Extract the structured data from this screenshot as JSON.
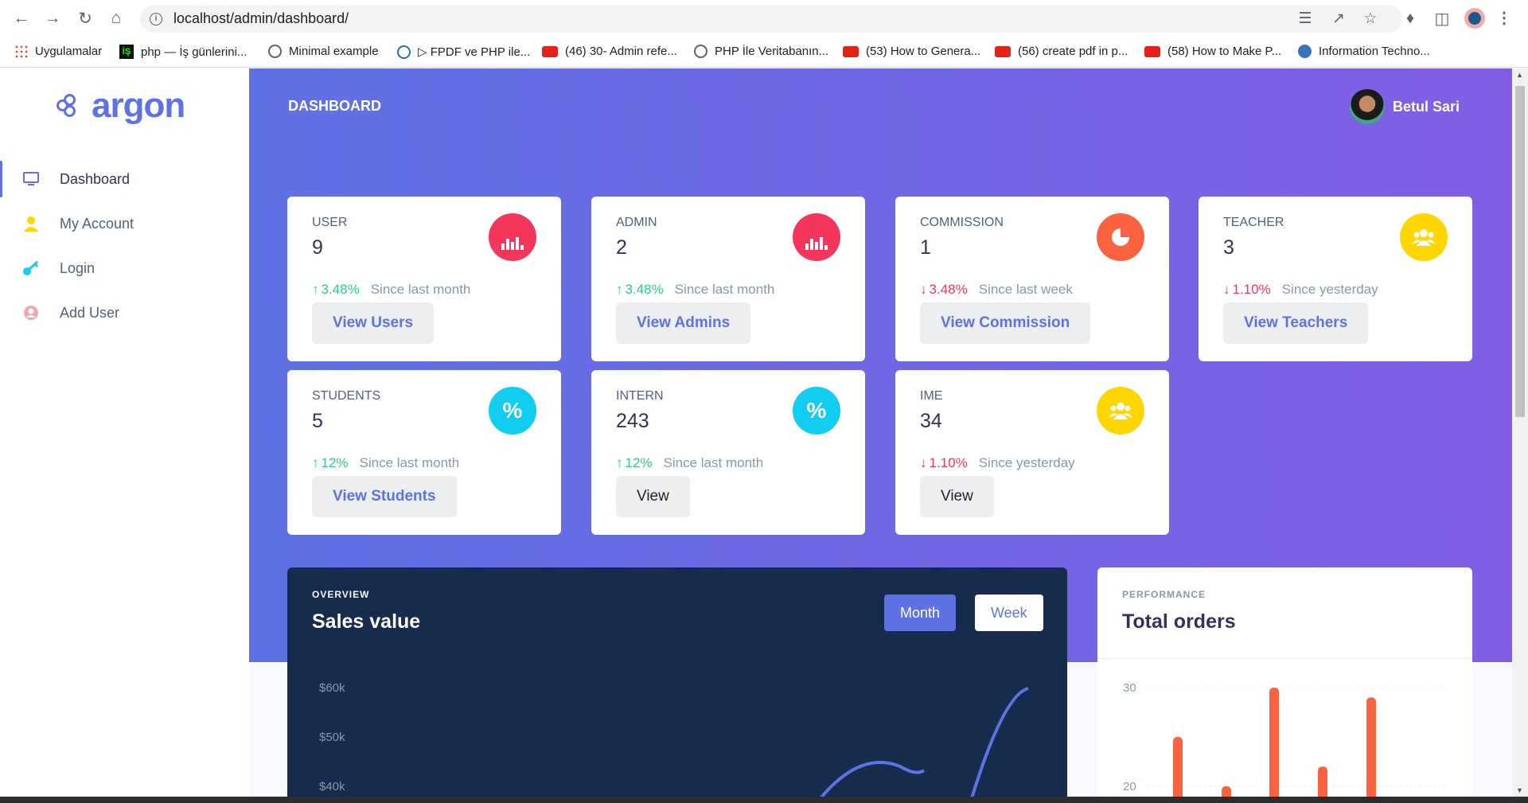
{
  "browser": {
    "url": "localhost/admin/dashboard/",
    "bookmarks": [
      {
        "label": "Uygulamalar",
        "icon": "apps-grid-icon"
      },
      {
        "label": "php — İş günlerini...",
        "icon": "php-favicon-icon"
      },
      {
        "label": "Minimal example",
        "icon": "globe-icon"
      },
      {
        "label": "▷ FPDF ve PHP ile...",
        "icon": "wordpress-icon"
      },
      {
        "label": "(46) 30- Admin refe...",
        "icon": "youtube-icon"
      },
      {
        "label": "PHP İle Veritabanın...",
        "icon": "globe-icon"
      },
      {
        "label": "(53) How to Genera...",
        "icon": "youtube-icon"
      },
      {
        "label": "(56) create pdf in p...",
        "icon": "youtube-icon"
      },
      {
        "label": "(58) How to Make P...",
        "icon": "youtube-icon"
      },
      {
        "label": "Information Techno...",
        "icon": "ge-icon"
      }
    ],
    "more_bookmarks": "»"
  },
  "sidebar": {
    "brand": "argon",
    "items": [
      {
        "label": "Dashboard",
        "icon": "monitor-icon",
        "color": "#5e72e4"
      },
      {
        "label": "My Account",
        "icon": "user-icon",
        "color": "#ffd600"
      },
      {
        "label": "Login",
        "icon": "key-icon",
        "color": "#11cdef"
      },
      {
        "label": "Add User",
        "icon": "user-circle-icon",
        "color": "#f3a4b5"
      }
    ]
  },
  "header": {
    "title": "DASHBOARD",
    "user_name": "Betul Sari"
  },
  "cards": [
    {
      "title": "USER",
      "value": "9",
      "trend": "up",
      "pct": "3.48%",
      "since": "Since last month",
      "button": "View Users",
      "icon": "chart-bar-icon",
      "color": "#f5365c"
    },
    {
      "title": "ADMIN",
      "value": "2",
      "trend": "up",
      "pct": "3.48%",
      "since": "Since last month",
      "button": "View Admins",
      "icon": "chart-bar-icon",
      "color": "#f5365c"
    },
    {
      "title": "COMMISSION",
      "value": "1",
      "trend": "down",
      "pct": "3.48%",
      "since": "Since last week",
      "button": "View Commission",
      "icon": "chart-pie-icon",
      "color": "#fb6340"
    },
    {
      "title": "TEACHER",
      "value": "3",
      "trend": "down",
      "pct": "1.10%",
      "since": "Since yesterday",
      "button": "View Teachers",
      "icon": "users-icon",
      "color": "#ffd600"
    },
    {
      "title": "STUDENTS",
      "value": "5",
      "trend": "up",
      "pct": "12%",
      "since": "Since last month",
      "button": "View Students",
      "icon": "percent-icon",
      "color": "#11cdef"
    },
    {
      "title": "INTERN",
      "value": "243",
      "trend": "up",
      "pct": "12%",
      "since": "Since last month",
      "button": "View",
      "icon": "percent-icon",
      "color": "#11cdef"
    },
    {
      "title": "IME",
      "value": "34",
      "trend": "down",
      "pct": "1.10%",
      "since": "Since yesterday",
      "button": "View",
      "icon": "users-icon",
      "color": "#ffd600"
    }
  ],
  "sales": {
    "kicker": "OVERVIEW",
    "title": "Sales value",
    "toggle_month": "Month",
    "toggle_week": "Week",
    "chart_data": {
      "type": "line",
      "y_ticks": [
        "$60k",
        "$50k",
        "$40k"
      ]
    }
  },
  "orders": {
    "kicker": "PERFORMANCE",
    "title": "Total orders",
    "chart_data": {
      "type": "bar",
      "y_ticks": [
        "30",
        "20"
      ],
      "values": [
        25,
        20,
        30,
        22,
        29
      ]
    }
  }
}
